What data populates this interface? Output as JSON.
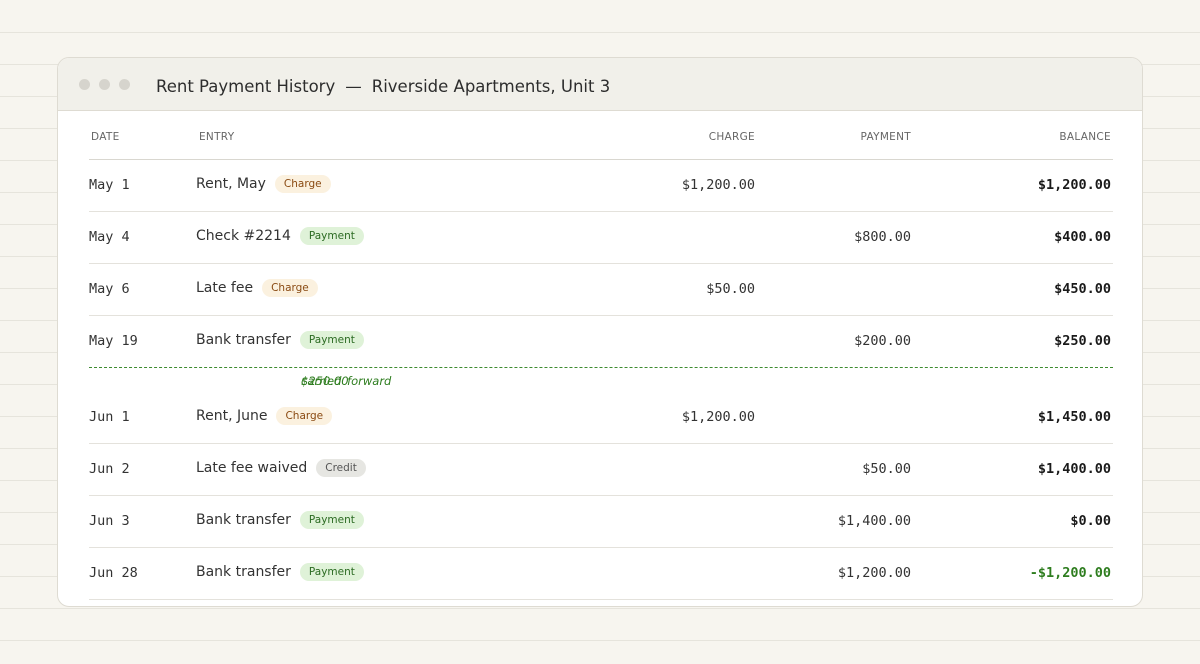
{
  "window": {
    "title": "Rent Payment History",
    "separator": "—",
    "subtitle": "Riverside Apartments, Unit 3"
  },
  "columns": {
    "date": "DATE",
    "entry": "ENTRY",
    "charge": "CHARGE",
    "payment": "PAYMENT",
    "balance": "BALANCE"
  },
  "rows": [
    {
      "date": "May 1",
      "entry": "Rent, May",
      "tag": "Charge",
      "charge": "$1,200.00",
      "payment": "",
      "balance": "$1,200.00"
    },
    {
      "date": "May 4",
      "entry": "Check #2214",
      "tag": "Payment",
      "charge": "",
      "payment": "$800.00",
      "balance": "$400.00"
    },
    {
      "date": "May 6",
      "entry": "Late fee",
      "tag": "Charge",
      "charge": "$50.00",
      "payment": "",
      "balance": "$450.00"
    },
    {
      "date": "May 19",
      "entry": "Bank transfer",
      "tag": "Payment",
      "charge": "",
      "payment": "$200.00",
      "balance": "$250.00"
    },
    {
      "date": "Jun 1",
      "entry": "Rent, June",
      "tag": "Charge",
      "charge": "$1,200.00",
      "payment": "",
      "balance": "$1,450.00"
    },
    {
      "date": "Jun 2",
      "entry": "Late fee waived",
      "tag": "Credit",
      "charge": "",
      "payment": "$50.00",
      "balance": "$1,400.00"
    },
    {
      "date": "Jun 3",
      "entry": "Bank transfer",
      "tag": "Payment",
      "charge": "",
      "payment": "$1,400.00",
      "balance": "$0.00"
    },
    {
      "date": "Jun 28",
      "entry": "Bank transfer",
      "tag": "Payment",
      "charge": "",
      "payment": "$1,200.00",
      "balance": "-$1,200.00"
    }
  ],
  "carry_forward": {
    "label": "carried forward",
    "amount": "$250.00"
  },
  "colors": {
    "charge_badge": "#fbf1df",
    "payment_badge": "#dff2d8",
    "credit_badge": "#e6e6e2",
    "negative_balance": "#2e7d1f",
    "carry_line": "#3d8b2f"
  }
}
